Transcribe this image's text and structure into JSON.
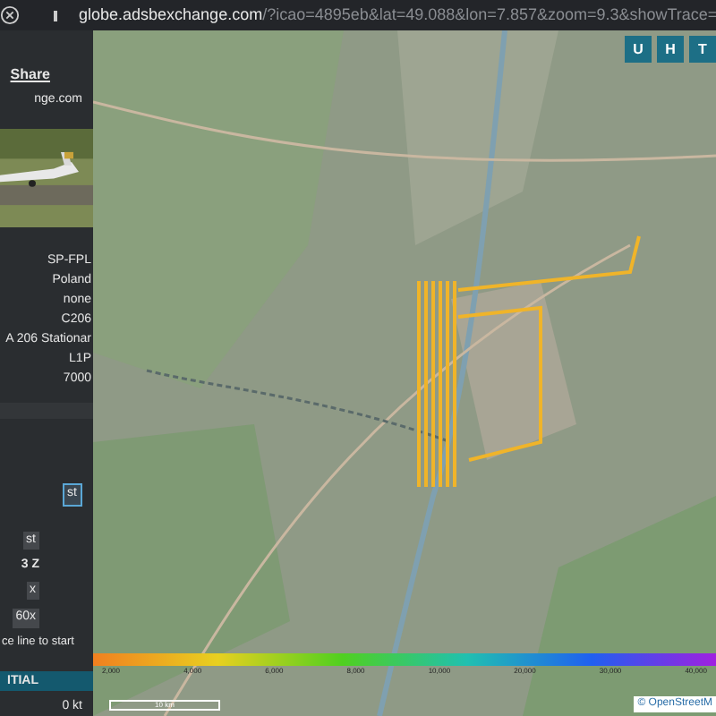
{
  "browser": {
    "url_host": "globe.adsbexchange.com",
    "url_rest": "/?icao=4895eb&lat=49.088&lon=7.857&zoom=9.3&showTrace="
  },
  "sidebar": {
    "share": "Share",
    "site": "nge.com",
    "details": [
      "SP-FPL",
      "Poland",
      "none",
      "C206",
      "A 206 Stationar",
      "L1P",
      "7000"
    ],
    "controls": [
      {
        "label": "st",
        "selected": true
      },
      {
        "label": "st",
        "selected": false
      }
    ],
    "info": [
      "3 Z"
    ],
    "buttons": [
      "x",
      "60x"
    ],
    "hint": "ce line to start",
    "status": "ITIAL",
    "speed": "0 kt"
  },
  "map": {
    "layer_buttons": [
      "U",
      "H",
      "T"
    ],
    "altitude_scale": [
      "2,000",
      "4,000",
      "6,000",
      "8,000",
      "10,000",
      "20,000",
      "30,000",
      "40,000"
    ],
    "scale": "10 km",
    "attribution": "© OpenStreetM"
  }
}
